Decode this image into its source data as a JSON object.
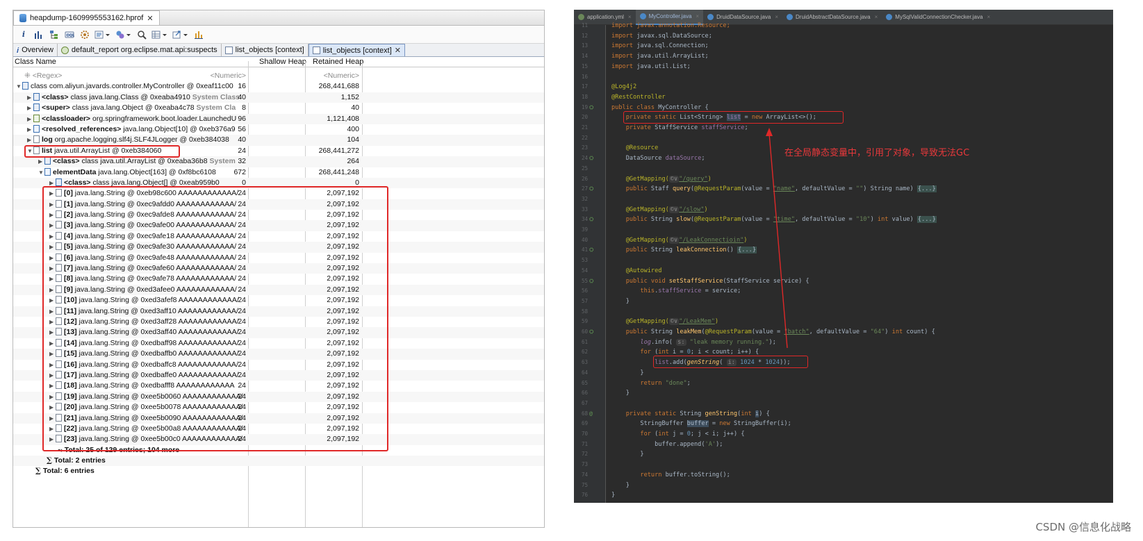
{
  "mat": {
    "editor_tab": "heapdump-1609995553162.hprof",
    "toolbar_icons": [
      "info-icon",
      "histogram-icon",
      "dominator-tree-icon",
      "oql-icon",
      "thread-overview-icon",
      "reports-dropdown-icon",
      "query-browser-dropdown-icon",
      "search-icon",
      "group-by-dropdown-icon",
      "export-dropdown-icon",
      "calculate-heap-icon"
    ],
    "query_tabs": [
      {
        "label": "Overview",
        "active": false
      },
      {
        "label": "default_report  org.eclipse.mat.api:suspects",
        "active": false
      },
      {
        "label": "list_objects [context]",
        "active": false
      },
      {
        "label": "list_objects [context]",
        "active": true
      }
    ],
    "columns": {
      "name": "Class Name",
      "shallow": "Shallow Heap",
      "retained": "Retained Heap"
    },
    "filter_row": {
      "name": "<Regex>",
      "shallow": "<Numeric>",
      "retained": "<Numeric>"
    },
    "rows": [
      {
        "pre": "",
        "bold": "",
        "text": "class com.aliyun.javards.controller.MyController @ 0xeaf11c00",
        "hint": "",
        "sh": "16",
        "rh": "268,441,688"
      },
      {
        "pre": "",
        "bold": "<class>",
        "text": " class java.lang.Class @ 0xeaba4910",
        "hint": " System Class",
        "sh": "40",
        "rh": "1,152"
      },
      {
        "pre": "",
        "bold": "<super>",
        "text": " class java.lang.Object @ 0xeaba4c78",
        "hint": " System Cla",
        "sh": "8",
        "rh": "40"
      },
      {
        "pre": "",
        "bold": "<classloader>",
        "text": " org.springframework.boot.loader.LaunchedU",
        "hint": "",
        "sh": "96",
        "rh": "1,121,408"
      },
      {
        "pre": "",
        "bold": "<resolved_references>",
        "text": " java.lang.Object[10] @ 0xeb376a9",
        "hint": "",
        "sh": "56",
        "rh": "400"
      },
      {
        "pre": "",
        "bold": "log",
        "text": " org.apache.logging.slf4j.SLF4JLogger @ 0xeb384038",
        "hint": "",
        "sh": "40",
        "rh": "104"
      },
      {
        "pre": "",
        "bold": "list",
        "text": " java.util.ArrayList @ 0xeb384060",
        "hint": "",
        "sh": "24",
        "rh": "268,441,272"
      },
      {
        "pre": "",
        "bold": "<class>",
        "text": " class java.util.ArrayList @ 0xeaba36b8",
        "hint": " System",
        "sh": "32",
        "rh": "264"
      },
      {
        "pre": "",
        "bold": "elementData",
        "text": " java.lang.Object[163] @ 0xf8bc6108",
        "hint": "",
        "sh": "672",
        "rh": "268,441,248"
      },
      {
        "pre": "",
        "bold": "<class>",
        "text": " class java.lang.Object[] @ 0xeab959b0",
        "hint": "",
        "sh": "0",
        "rh": "0"
      },
      {
        "pre": "",
        "bold": "[0]",
        "text": " java.lang.String @ 0xeb98c600  AAAAAAAAAAAA/",
        "hint": "",
        "sh": "24",
        "rh": "2,097,192"
      },
      {
        "pre": "",
        "bold": "[1]",
        "text": " java.lang.String @ 0xec9afdd0  AAAAAAAAAAAA/",
        "hint": "",
        "sh": "24",
        "rh": "2,097,192"
      },
      {
        "pre": "",
        "bold": "[2]",
        "text": " java.lang.String @ 0xec9afde8  AAAAAAAAAAAA/",
        "hint": "",
        "sh": "24",
        "rh": "2,097,192"
      },
      {
        "pre": "",
        "bold": "[3]",
        "text": " java.lang.String @ 0xec9afe00  AAAAAAAAAAAA/",
        "hint": "",
        "sh": "24",
        "rh": "2,097,192"
      },
      {
        "pre": "",
        "bold": "[4]",
        "text": " java.lang.String @ 0xec9afe18  AAAAAAAAAAAA/",
        "hint": "",
        "sh": "24",
        "rh": "2,097,192"
      },
      {
        "pre": "",
        "bold": "[5]",
        "text": " java.lang.String @ 0xec9afe30  AAAAAAAAAAAA/",
        "hint": "",
        "sh": "24",
        "rh": "2,097,192"
      },
      {
        "pre": "",
        "bold": "[6]",
        "text": " java.lang.String @ 0xec9afe48  AAAAAAAAAAAA/",
        "hint": "",
        "sh": "24",
        "rh": "2,097,192"
      },
      {
        "pre": "",
        "bold": "[7]",
        "text": " java.lang.String @ 0xec9afe60  AAAAAAAAAAAA/",
        "hint": "",
        "sh": "24",
        "rh": "2,097,192"
      },
      {
        "pre": "",
        "bold": "[8]",
        "text": " java.lang.String @ 0xec9afe78  AAAAAAAAAAAA/",
        "hint": "",
        "sh": "24",
        "rh": "2,097,192"
      },
      {
        "pre": "",
        "bold": "[9]",
        "text": " java.lang.String @ 0xed3afee0  AAAAAAAAAAAA/",
        "hint": "",
        "sh": "24",
        "rh": "2,097,192"
      },
      {
        "pre": "",
        "bold": "[10]",
        "text": " java.lang.String @ 0xed3afef8  AAAAAAAAAAAA/",
        "hint": "",
        "sh": "24",
        "rh": "2,097,192"
      },
      {
        "pre": "",
        "bold": "[11]",
        "text": " java.lang.String @ 0xed3aff10  AAAAAAAAAAAA/",
        "hint": "",
        "sh": "24",
        "rh": "2,097,192"
      },
      {
        "pre": "",
        "bold": "[12]",
        "text": " java.lang.String @ 0xed3aff28  AAAAAAAAAAAA/",
        "hint": "",
        "sh": "24",
        "rh": "2,097,192"
      },
      {
        "pre": "",
        "bold": "[13]",
        "text": " java.lang.String @ 0xed3aff40  AAAAAAAAAAAA/",
        "hint": "",
        "sh": "24",
        "rh": "2,097,192"
      },
      {
        "pre": "",
        "bold": "[14]",
        "text": " java.lang.String @ 0xedbaff98  AAAAAAAAAAAA/",
        "hint": "",
        "sh": "24",
        "rh": "2,097,192"
      },
      {
        "pre": "",
        "bold": "[15]",
        "text": " java.lang.String @ 0xedbaffb0  AAAAAAAAAAAA/",
        "hint": "",
        "sh": "24",
        "rh": "2,097,192"
      },
      {
        "pre": "",
        "bold": "[16]",
        "text": " java.lang.String @ 0xedbaffc8  AAAAAAAAAAAA/",
        "hint": "",
        "sh": "24",
        "rh": "2,097,192"
      },
      {
        "pre": "",
        "bold": "[17]",
        "text": " java.lang.String @ 0xedbaffe0  AAAAAAAAAAAA/",
        "hint": "",
        "sh": "24",
        "rh": "2,097,192"
      },
      {
        "pre": "",
        "bold": "[18]",
        "text": " java.lang.String @ 0xedbafff8  AAAAAAAAAAAA",
        "hint": "",
        "sh": "24",
        "rh": "2,097,192"
      },
      {
        "pre": "",
        "bold": "[19]",
        "text": " java.lang.String @ 0xee5b0060  AAAAAAAAAAAA/",
        "hint": "",
        "sh": "24",
        "rh": "2,097,192"
      },
      {
        "pre": "",
        "bold": "[20]",
        "text": " java.lang.String @ 0xee5b0078  AAAAAAAAAAAA/",
        "hint": "",
        "sh": "24",
        "rh": "2,097,192"
      },
      {
        "pre": "",
        "bold": "[21]",
        "text": " java.lang.String @ 0xee5b0090  AAAAAAAAAAAA/",
        "hint": "",
        "sh": "24",
        "rh": "2,097,192"
      },
      {
        "pre": "",
        "bold": "[22]",
        "text": " java.lang.String @ 0xee5b00a8  AAAAAAAAAAAA/",
        "hint": "",
        "sh": "24",
        "rh": "2,097,192"
      },
      {
        "pre": "",
        "bold": "[23]",
        "text": " java.lang.String @ 0xee5b00c0  AAAAAAAAAAAA/",
        "hint": "",
        "sh": "24",
        "rh": "2,097,192"
      }
    ],
    "totals": {
      "inner": "Total: 25 of 129 entries; 104 more",
      "mid": "Total: 2 entries",
      "outer": "Total: 6 entries"
    }
  },
  "ide": {
    "tabs": [
      {
        "label": "application.yml",
        "active": false,
        "color": "#6a8759"
      },
      {
        "label": "MyController.java",
        "active": true,
        "color": "#4a88c7"
      },
      {
        "label": "DruidDataSource.java",
        "active": false,
        "color": "#4a88c7"
      },
      {
        "label": "DruidAbstractDataSource.java",
        "active": false,
        "color": "#4a88c7"
      },
      {
        "label": "MySqlValidConnectionChecker.java",
        "active": false,
        "color": "#4a88c7"
      }
    ],
    "line_numbers": [
      "11",
      "12",
      "13",
      "14",
      "15",
      "16",
      "17",
      "18",
      "19",
      "20",
      "21",
      "22",
      "23",
      "24",
      "25",
      "26",
      "27",
      "32",
      "33",
      "34",
      "39",
      "40",
      "41",
      "53",
      "54",
      "55",
      "57",
      "58",
      "59",
      "60",
      "61",
      "62",
      "63",
      "64",
      "65",
      "66",
      "67",
      "68",
      "69",
      "70",
      "71",
      "72",
      "73",
      "74",
      "75",
      "76"
    ],
    "code": {
      "l11": "import javax.annotation.Resource;",
      "l12_kw": "import",
      "l12": " javax.sql.DataSource;",
      "l13_kw": "import",
      "l13": " java.sql.Connection;",
      "l14_kw": "import",
      "l14": " java.util.ArrayList;",
      "l15_kw": "import",
      "l15": " java.util.List;",
      "l17": "@Log4j2",
      "l18": "@RestController",
      "l19_kw": "public class",
      "l19": " MyController {",
      "l20_kw": "private static",
      "l20_a": " List<String> ",
      "l20_sel": "list",
      "l20_b": " = ",
      "l20_new": "new",
      "l20_c": " ArrayList<>();",
      "l21_kw": "private",
      "l21_a": " StaffService ",
      "l21_f": "staffService",
      "l21_b": ";",
      "l23": "@Resource",
      "l24_a": "DataSource ",
      "l24_f": "dataSource",
      "l24_b": ";",
      "l26_ann": "@GetMapping(",
      "l26_chip": "©∨",
      "l26_str": "\"/query\"",
      "l26_c": ")",
      "l27_kw": "public",
      "l27_a": " Staff ",
      "l27_fn": "query",
      "l27_b": "(",
      "l27_ann": "@RequestParam",
      "l27_c": "(value = ",
      "l27_s1": "\"name\"",
      "l27_d": ", defaultValue = ",
      "l27_s2": "\"\"",
      "l27_e": ") String name) ",
      "l27_fold": "{...}",
      "l33_ann": "@GetMapping(",
      "l33_chip": "©∨",
      "l33_str": "\"/slow\"",
      "l33_c": ")",
      "l34_kw": "public",
      "l34_a": " String ",
      "l34_fn": "slow",
      "l34_b": "(",
      "l34_ann": "@RequestParam",
      "l34_c": "(value = ",
      "l34_s1": "\"time\"",
      "l34_d": ", defaultValue = ",
      "l34_s2": "\"10\"",
      "l34_e": ") ",
      "l34_kw2": "int",
      "l34_f": " value) ",
      "l34_fold": "{...}",
      "l40_ann": "@GetMapping(",
      "l40_chip": "©∨",
      "l40_str": "\"/LeakConnectioin\"",
      "l40_c": ")",
      "l41_kw": "public",
      "l41_a": " String ",
      "l41_fn": "leakConnection",
      "l41_b": "() ",
      "l41_fold": "{...}",
      "l54": "@Autowired",
      "l55_kw": "public void",
      "l55_fn": " setStaffService",
      "l55_a": "(StaffService service) {",
      "l56_kw": "this",
      "l56_a": ".",
      "l56_f": "staffService",
      "l56_b": " = service;",
      "l57": "}",
      "l59_ann": "@GetMapping(",
      "l59_chip": "©∨",
      "l59_str": "\"/LeakMem\"",
      "l59_c": ")",
      "l60_kw": "public",
      "l60_a": " String ",
      "l60_fn": "leakMem",
      "l60_b": "(",
      "l60_ann": "@RequestParam",
      "l60_c": "(value = ",
      "l60_s1": "\"batch\"",
      "l60_d": ", defaultValue = ",
      "l60_s2": "\"64\"",
      "l60_e": ") ",
      "l60_kw2": "int",
      "l60_f": " count) {",
      "l61_f": "log",
      "l61_a": ".info( ",
      "l61_chip": "s:",
      "l61_str": " \"leak memory running.\"",
      "l61_b": ");",
      "l62_kw": "for",
      "l62_a": " (",
      "l62_kw2": "int",
      "l62_b": " i = ",
      "l62_n": "0",
      "l62_c": "; i < count; i++) {",
      "l63_f": "list",
      "l63_a": ".add(",
      "l63_fn": "genString",
      "l63_b": "( ",
      "l63_chip": "i:",
      "l63_n": " 1024",
      "l63_c": " * ",
      "l63_n2": "1024",
      "l63_d": "));",
      "l64": "}",
      "l65_kw": "return",
      "l65_str": " \"done\"",
      "l65_a": ";",
      "l66": "}",
      "l68_kw": "private static",
      "l68_a": " String ",
      "l68_fn": "genString",
      "l68_b": "(",
      "l68_kw2": "int",
      "l68_c": " ",
      "l68_sel": "i",
      "l68_d": ") {",
      "l69_a": "StringBuffer ",
      "l69_sel": "buffer",
      "l69_b": " = ",
      "l69_kw": "new",
      "l69_c": " StringBuffer(i);",
      "l70_kw": "for",
      "l70_a": " (",
      "l70_kw2": "int",
      "l70_b": " j = ",
      "l70_n": "0",
      "l70_c": "; j < i; j++) {",
      "l71_a": "buffer.append(",
      "l71_str": "'A'",
      "l71_b": ");",
      "l72": "}",
      "l74_kw": "return",
      "l74_a": " buffer.toString();",
      "l75": "}",
      "l76": "}"
    },
    "annotation": "在全局静态变量中，引用了对象，导致无法GC"
  },
  "watermark": "CSDN @信息化战略",
  "colors": {
    "highlight": "#e02828",
    "ide_bg": "#2b2b2b"
  }
}
